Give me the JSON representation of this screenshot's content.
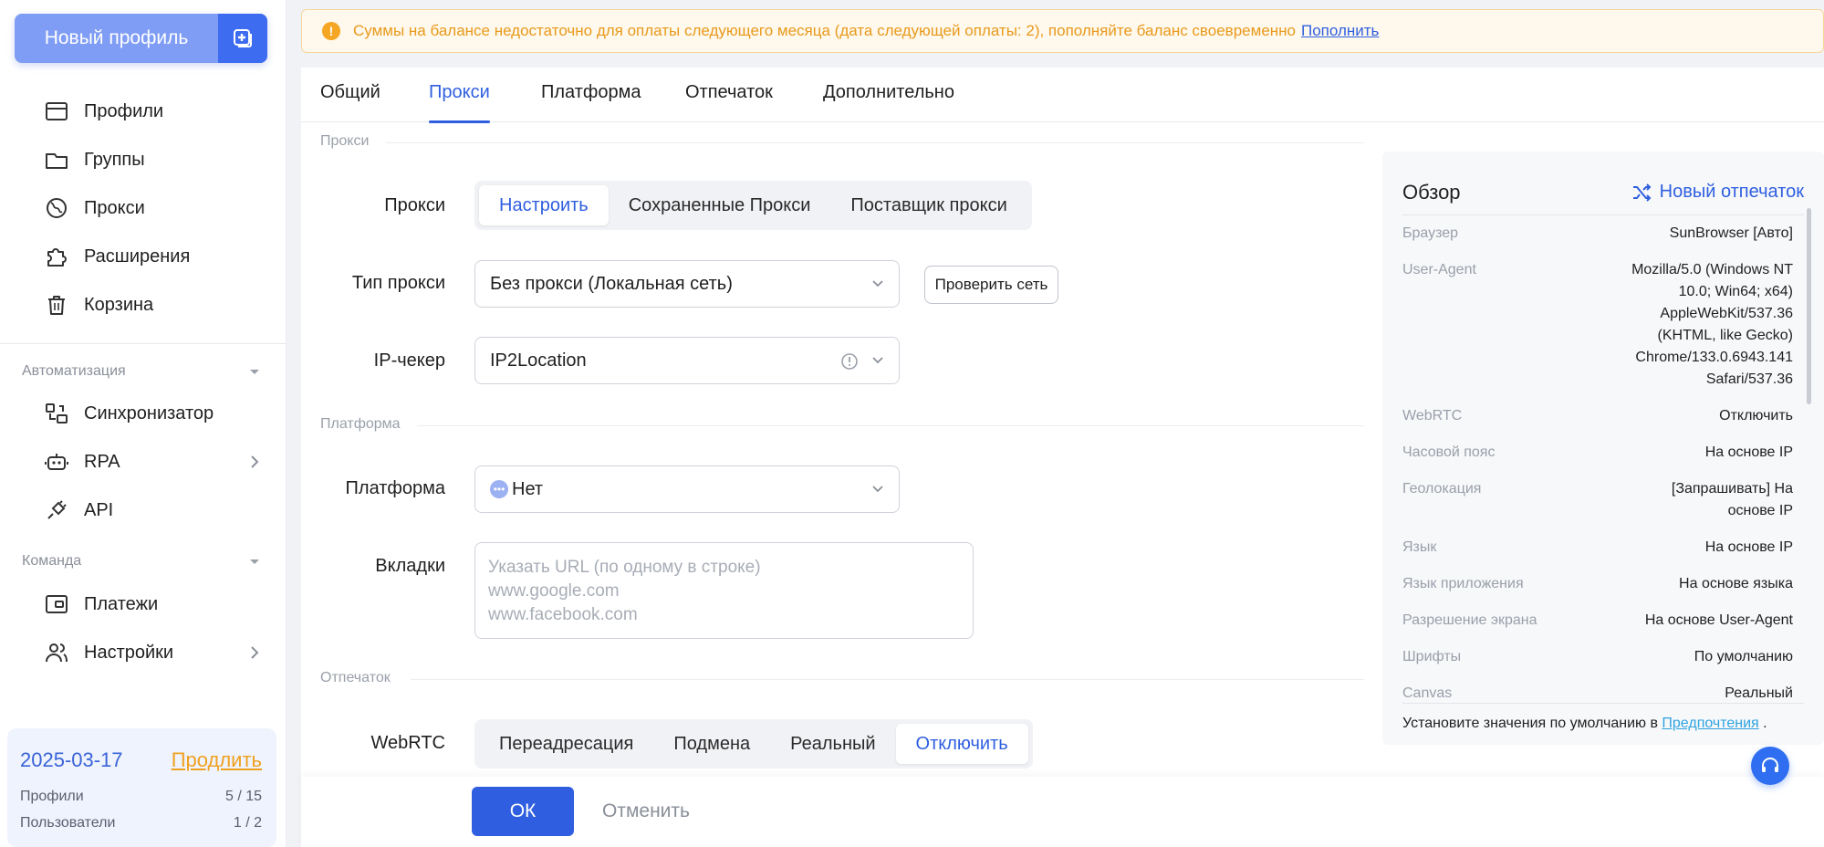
{
  "sidebar": {
    "new_profile_label": "Новый профиль",
    "items": [
      {
        "label": "Профили",
        "icon": "browser-window-icon"
      },
      {
        "label": "Группы",
        "icon": "folder-icon"
      },
      {
        "label": "Прокси",
        "icon": "globe-icon"
      },
      {
        "label": "Расширения",
        "icon": "puzzle-icon"
      },
      {
        "label": "Корзина",
        "icon": "trash-icon"
      }
    ],
    "automation": {
      "title": "Автоматизация",
      "items": [
        {
          "label": "Синхронизатор",
          "icon": "sync-icon"
        },
        {
          "label": "RPA",
          "icon": "robot-icon"
        },
        {
          "label": "API",
          "icon": "plug-icon"
        }
      ]
    },
    "team": {
      "title": "Команда",
      "items": [
        {
          "label": "Платежи",
          "icon": "wallet-icon"
        },
        {
          "label": "Настройки",
          "icon": "users-icon"
        }
      ]
    },
    "plan": {
      "date": "2025-03-17",
      "extend": "Продлить",
      "profiles_label": "Профили",
      "profiles_value": "5 / 15",
      "users_label": "Пользователи",
      "users_value": "1 / 2"
    }
  },
  "alert": {
    "text": "Суммы на балансе недостаточно для оплаты следующего месяца (дата следующей оплаты: 2), пополняйте баланс своевременно",
    "link": "Пополнить"
  },
  "tabs": [
    "Общий",
    "Прокси",
    "Платформа",
    "Отпечаток",
    "Дополнительно"
  ],
  "active_tab": "Прокси",
  "proxy_section": {
    "title": "Прокси",
    "proxy_label": "Прокси",
    "proxy_options": [
      "Настроить",
      "Сохраненные Прокси",
      "Поставщик прокси"
    ],
    "proxy_selected": "Настроить",
    "type_label": "Тип прокси",
    "type_value": "Без прокси (Локальная сеть)",
    "check_button": "Проверить сеть",
    "checker_label": "IP-чекер",
    "checker_value": "IP2Location"
  },
  "platform_section": {
    "title": "Платформа",
    "platform_label": "Платформа",
    "platform_value": "Нет",
    "tabs_label": "Вкладки",
    "tabs_placeholder_lines": [
      "Указать URL (по одному в строке)",
      "www.google.com",
      "www.facebook.com"
    ]
  },
  "fingerprint_section": {
    "title": "Отпечаток",
    "webrtc_label": "WebRTC",
    "webrtc_options": [
      "Переадресация",
      "Подмена",
      "Реальный",
      "Отключить"
    ],
    "webrtc_selected": "Отключить"
  },
  "overview": {
    "title": "Обзор",
    "new_fingerprint": "Новый отпечаток",
    "rows": [
      {
        "k": "Браузер",
        "v": "SunBrowser [Авто]"
      },
      {
        "k": "User-Agent",
        "v": "Mozilla/5.0 (Windows NT 10.0; Win64; x64) AppleWebKit/537.36 (KHTML, like Gecko) Chrome/133.0.6943.141 Safari/537.36"
      },
      {
        "k": "WebRTC",
        "v": "Отключить"
      },
      {
        "k": "Часовой пояс",
        "v": "На основе IP"
      },
      {
        "k": "Геолокация",
        "v": "[Запрашивать] На основе IP"
      },
      {
        "k": "Язык",
        "v": "На основе IP"
      },
      {
        "k": "Язык приложения",
        "v": "На основе языка"
      },
      {
        "k": "Разрешение экрана",
        "v": "На основе User-Agent"
      },
      {
        "k": "Шрифты",
        "v": "По умолчанию"
      },
      {
        "k": "Canvas",
        "v": "Реальный"
      }
    ],
    "footer_text": "Установите значения по умолчанию в",
    "footer_link": "Предпочтения",
    "footer_end": "."
  },
  "footer": {
    "ok": "ОК",
    "cancel": "Отменить"
  },
  "colors": {
    "accent": "#2f5fe0",
    "warning": "#e89a1c",
    "extend": "#f0a020"
  }
}
